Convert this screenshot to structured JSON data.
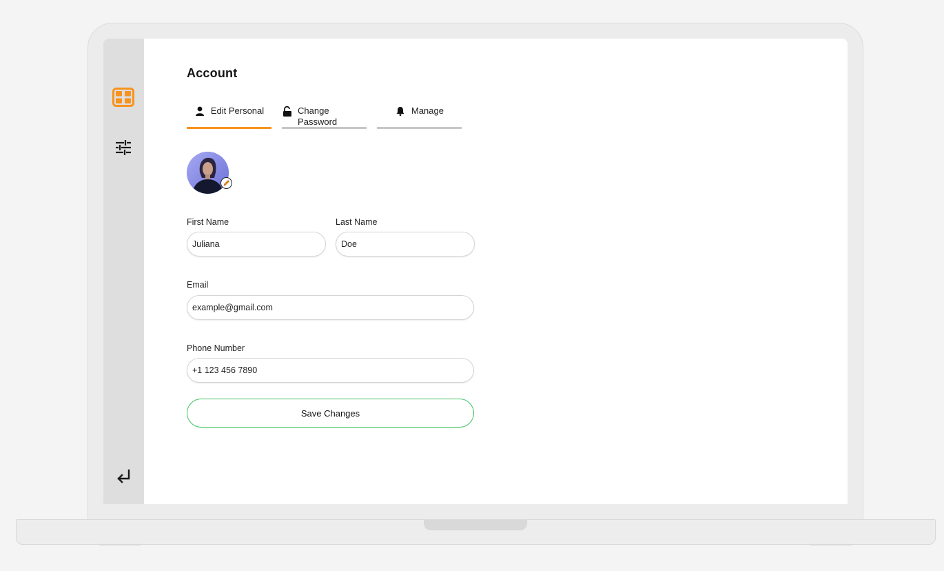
{
  "page": {
    "title": "Account"
  },
  "colors": {
    "accent": "#f7931e",
    "save_border": "#3fc25e",
    "sidebar_bg": "#dedede"
  },
  "sidebar": {
    "items": [
      {
        "icon": "dashboard-grid-icon",
        "active": true
      },
      {
        "icon": "sliders-icon",
        "active": false
      }
    ],
    "logout_icon": "return-arrow-icon"
  },
  "tabs": [
    {
      "label": "Edit Personal",
      "icon": "user-icon",
      "active": true
    },
    {
      "label": "Change Password",
      "icon": "unlock-icon",
      "active": false
    },
    {
      "label": "Manage",
      "icon": "bell-icon",
      "active": false
    }
  ],
  "profile": {
    "avatar_icon": "profile-photo",
    "edit_icon": "pencil-icon"
  },
  "form": {
    "first_name": {
      "label": "First Name",
      "value": "Juliana"
    },
    "last_name": {
      "label": "Last Name",
      "value": "Doe"
    },
    "email": {
      "label": "Email",
      "value": "example@gmail.com"
    },
    "phone": {
      "label": "Phone Number",
      "value": "+1 123 456 7890"
    },
    "save_label": "Save Changes"
  }
}
